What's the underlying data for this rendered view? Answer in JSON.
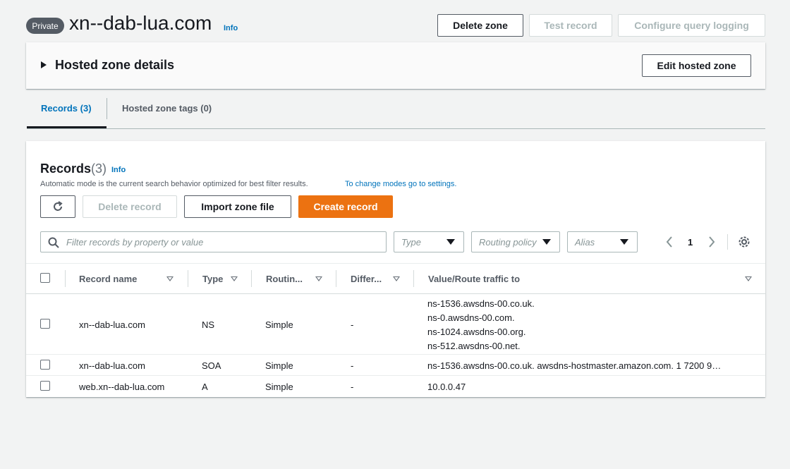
{
  "header": {
    "badge": "Private",
    "zone_name": "xn--dab-lua.com",
    "info": "Info",
    "delete_zone": "Delete zone",
    "test_record": "Test record",
    "configure_logging": "Configure query logging"
  },
  "details": {
    "title": "Hosted zone details",
    "edit": "Edit hosted zone"
  },
  "tabs": [
    {
      "label": "Records (3)"
    },
    {
      "label": "Hosted zone tags (0)"
    }
  ],
  "records": {
    "title": "Records",
    "count": "(3)",
    "info": "Info",
    "description": "Automatic mode is the current search behavior optimized for best filter results.",
    "link": "To change modes go to settings.",
    "delete": "Delete record",
    "import": "Import zone file",
    "create": "Create record",
    "search_placeholder": "Filter records by property or value",
    "filters": {
      "type": "Type",
      "routing": "Routing policy",
      "alias": "Alias"
    },
    "page": "1",
    "columns": [
      "Record name",
      "Type",
      "Routin...",
      "Differ...",
      "Value/Route traffic to"
    ],
    "rows": [
      {
        "name": "xn--dab-lua.com",
        "type": "NS",
        "routing": "Simple",
        "differ": "-",
        "values": [
          "ns-1536.awsdns-00.co.uk.",
          "ns-0.awsdns-00.com.",
          "ns-1024.awsdns-00.org.",
          "ns-512.awsdns-00.net."
        ]
      },
      {
        "name": "xn--dab-lua.com",
        "type": "SOA",
        "routing": "Simple",
        "differ": "-",
        "values": [
          "ns-1536.awsdns-00.co.uk. awsdns-hostmaster.amazon.com. 1 7200 9…"
        ]
      },
      {
        "name": "web.xn--dab-lua.com",
        "type": "A",
        "routing": "Simple",
        "differ": "-",
        "values": [
          "10.0.0.47"
        ]
      }
    ]
  },
  "colors": {
    "accent": "#0073bb",
    "primary": "#ec7211"
  }
}
